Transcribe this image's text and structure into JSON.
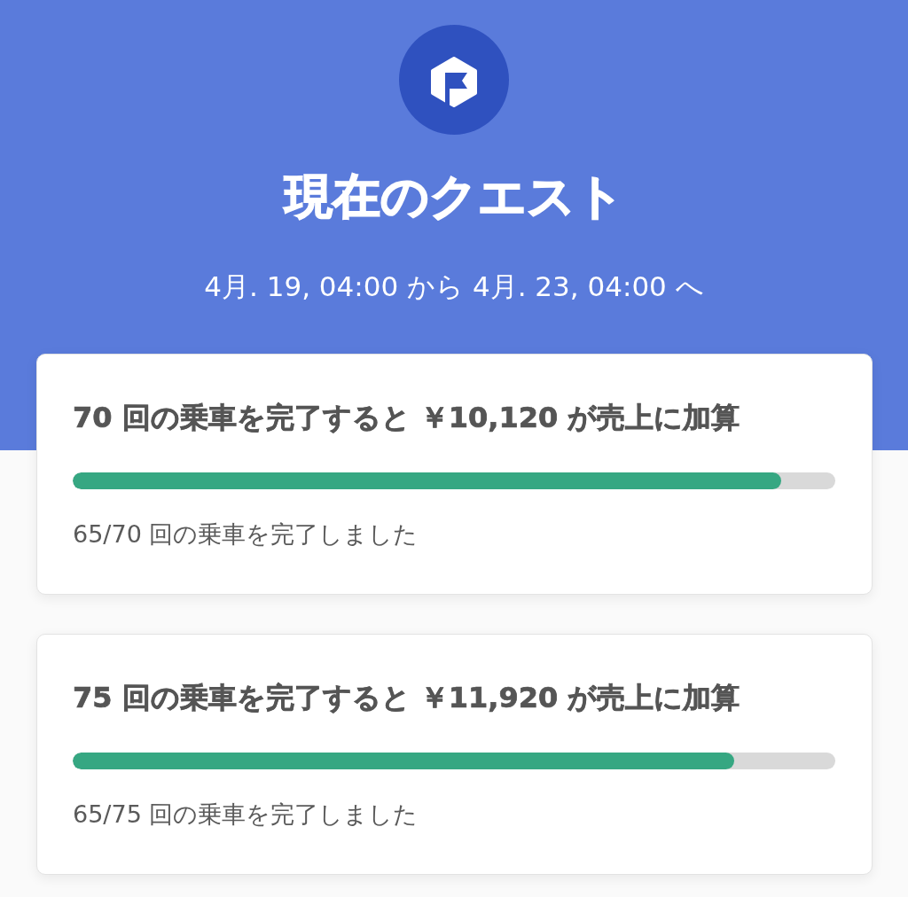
{
  "header": {
    "title": "現在のクエスト",
    "period": "4月. 19, 04:00 から 4月. 23, 04:00 へ"
  },
  "quests": [
    {
      "title": "70 回の乗車を完了すると ￥10,120 が売上に加算",
      "level": 0.929,
      "progress": "65/70 回の乗車を完了しました"
    },
    {
      "title": "75 回の乗車を完了すると ￥11,920 が売上に加算",
      "level": 0.867,
      "progress": "65/75 回の乗車を完了しました"
    }
  ]
}
